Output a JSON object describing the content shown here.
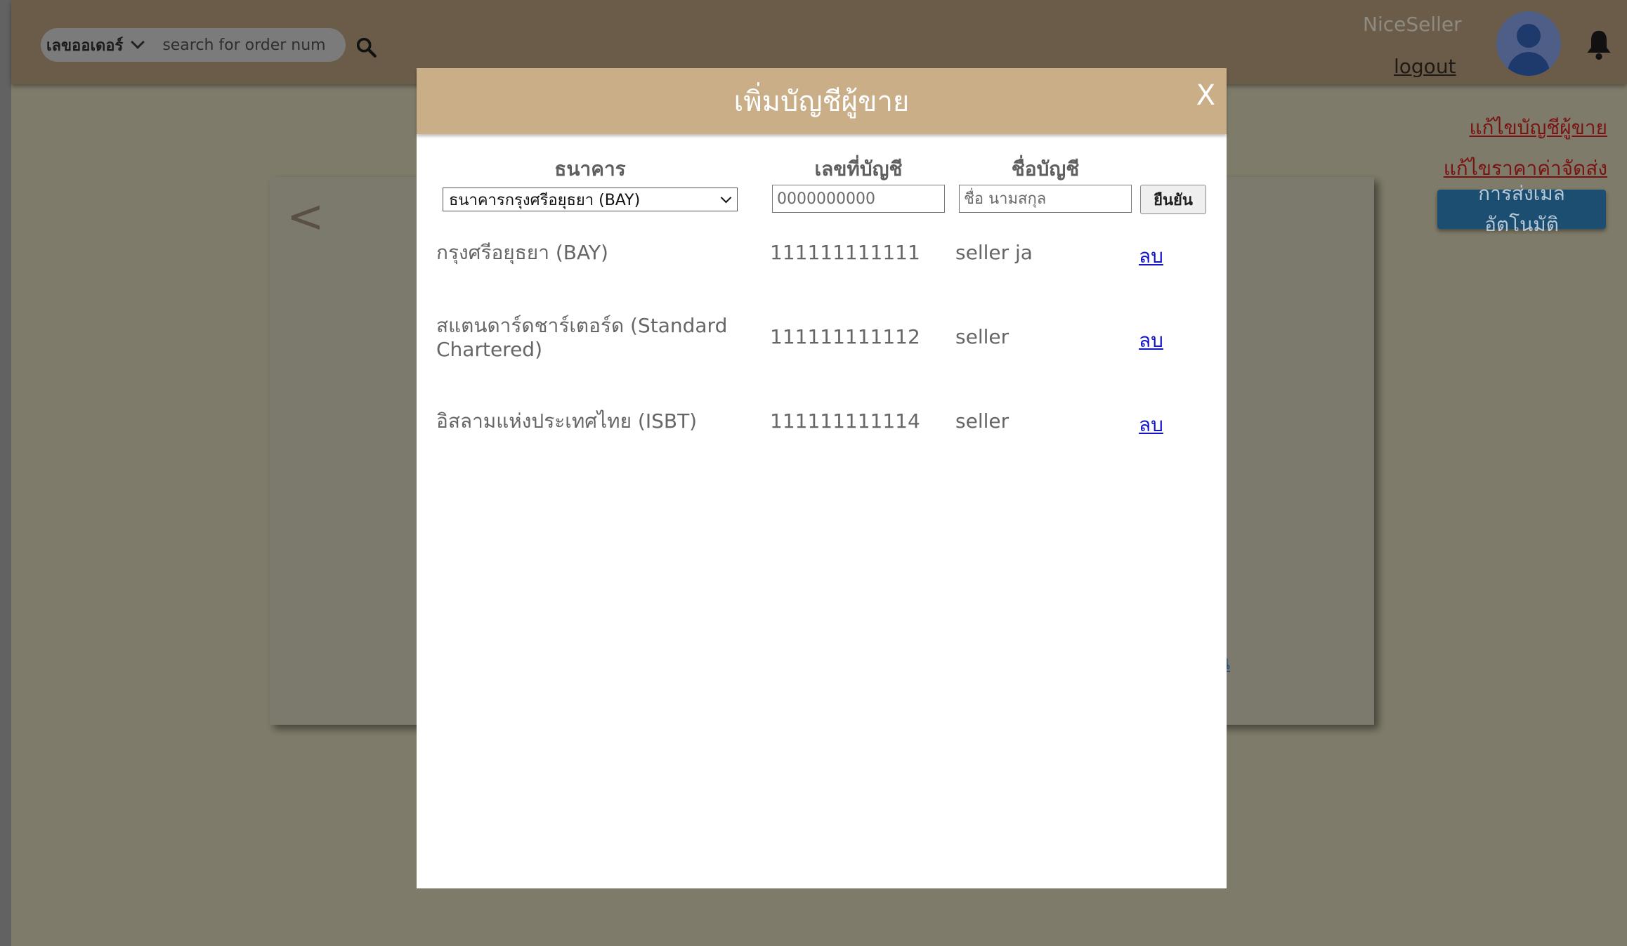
{
  "header": {
    "search_type": "เลขออเดอร์",
    "search_placeholder": "search for order num",
    "username": "NiceSeller",
    "logout": "logout"
  },
  "side_links": {
    "edit_account": "แก้ไขบัญชีผู้ขาย",
    "edit_shipping": "แก้ไขราคาค่าจัดส่ง",
    "auto_mail": "การส่งเมลอัตโนมัติ"
  },
  "background": {
    "back": "<",
    "partial_link": "น"
  },
  "modal": {
    "title": "เพิ่มบัญชีผู้ขาย",
    "close": "X",
    "labels": {
      "bank": "ธนาคาร",
      "account_number": "เลขที่บัญชี",
      "account_name": "ชื่อบัญชี"
    },
    "bank_selected": "ธนาคารกรุงศรีอยุธยา (BAY)",
    "account_number_placeholder": "0000000000",
    "account_name_placeholder": "ชื่อ นามสกุล",
    "confirm": "ยืนยัน",
    "accounts": [
      {
        "bank": "กรุงศรีอยุธยา (BAY)",
        "number": "111111111111",
        "name": "seller ja",
        "delete": "ลบ"
      },
      {
        "bank": "สแตนดาร์ดชาร์เตอร์ด (Standard Chartered)",
        "number": "111111111112",
        "name": "seller",
        "delete": "ลบ"
      },
      {
        "bank": "อิสลามแห่งประเทศไทย (ISBT)",
        "number": "111111111114",
        "name": "seller",
        "delete": "ลบ"
      }
    ]
  },
  "colors": {
    "header_bg": "#6b5c49",
    "modal_header": "#c9ae88",
    "link_red": "#7a1212",
    "button_blue": "#1c4e72",
    "delete_link": "#1414c8"
  }
}
